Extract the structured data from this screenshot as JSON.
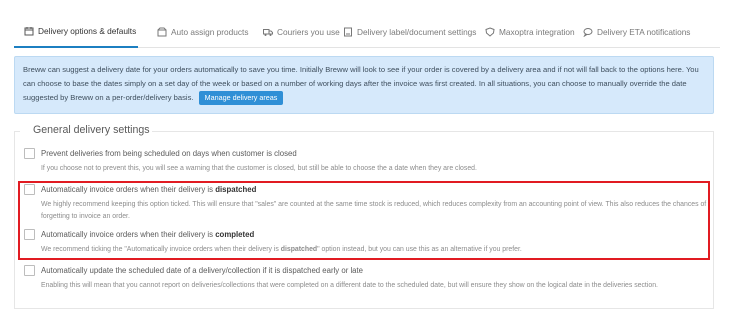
{
  "tabs": [
    {
      "label": "Delivery options & defaults",
      "icon": "calendar-icon",
      "active": true
    },
    {
      "label": "Auto assign products",
      "icon": "box-icon",
      "active": false
    },
    {
      "label": "Couriers you use",
      "icon": "truck-icon",
      "active": false
    },
    {
      "label": "Delivery label/document settings",
      "icon": "document-icon",
      "active": false
    },
    {
      "label": "Maxoptra integration",
      "icon": "shield-icon",
      "active": false
    },
    {
      "label": "Delivery ETA notifications",
      "icon": "chat-icon",
      "active": false
    }
  ],
  "info": {
    "text": "Breww can suggest a delivery date for your orders automatically to save you time. Initially Breww will look to see if your order is covered by a delivery area and if not will fall back to the options here. You can choose to base the dates simply on a set day of the week or based on a number of working days after the invoice was first created. In all situations, you can choose to manually override the date suggested by Breww on a per-order/delivery basis.",
    "button_label": "Manage delivery areas"
  },
  "section": {
    "legend": "General delivery settings",
    "options": [
      {
        "label": "Prevent deliveries from being scheduled on days when customer is closed",
        "help": "If you choose not to prevent this, you will see a warning that the customer is closed, but still be able to choose the a date when they are closed.",
        "checked": false
      },
      {
        "label_prefix": "Automatically invoice orders when their delivery is ",
        "label_bold": "dispatched",
        "help": "We highly recommend keeping this option ticked. This will ensure that \"sales\" are counted at the same time stock is reduced, which reduces complexity from an accounting point of view. This also reduces the chances of forgetting to invoice an order.",
        "checked": false
      },
      {
        "label_prefix": "Automatically invoice orders when their delivery is ",
        "label_bold": "completed",
        "help_prefix": "We recommend ticking the \"Automatically invoice orders when their delivery is ",
        "help_bold": "dispatched",
        "help_suffix": "\" option instead, but you can use this as an alternative if you prefer.",
        "checked": false
      },
      {
        "label": "Automatically update the scheduled date of a delivery/collection if it is dispatched early or late",
        "help": "Enabling this will mean that you cannot report on deliveries/collections that were completed on a different date to the scheduled date, but will ensure they show on the logical date in the deliveries section.",
        "checked": false
      }
    ]
  },
  "colors": {
    "accent": "#1c7fc1",
    "info_bg": "#d6e9fb",
    "button": "#2f8fd6",
    "highlight": "#e11b22"
  }
}
